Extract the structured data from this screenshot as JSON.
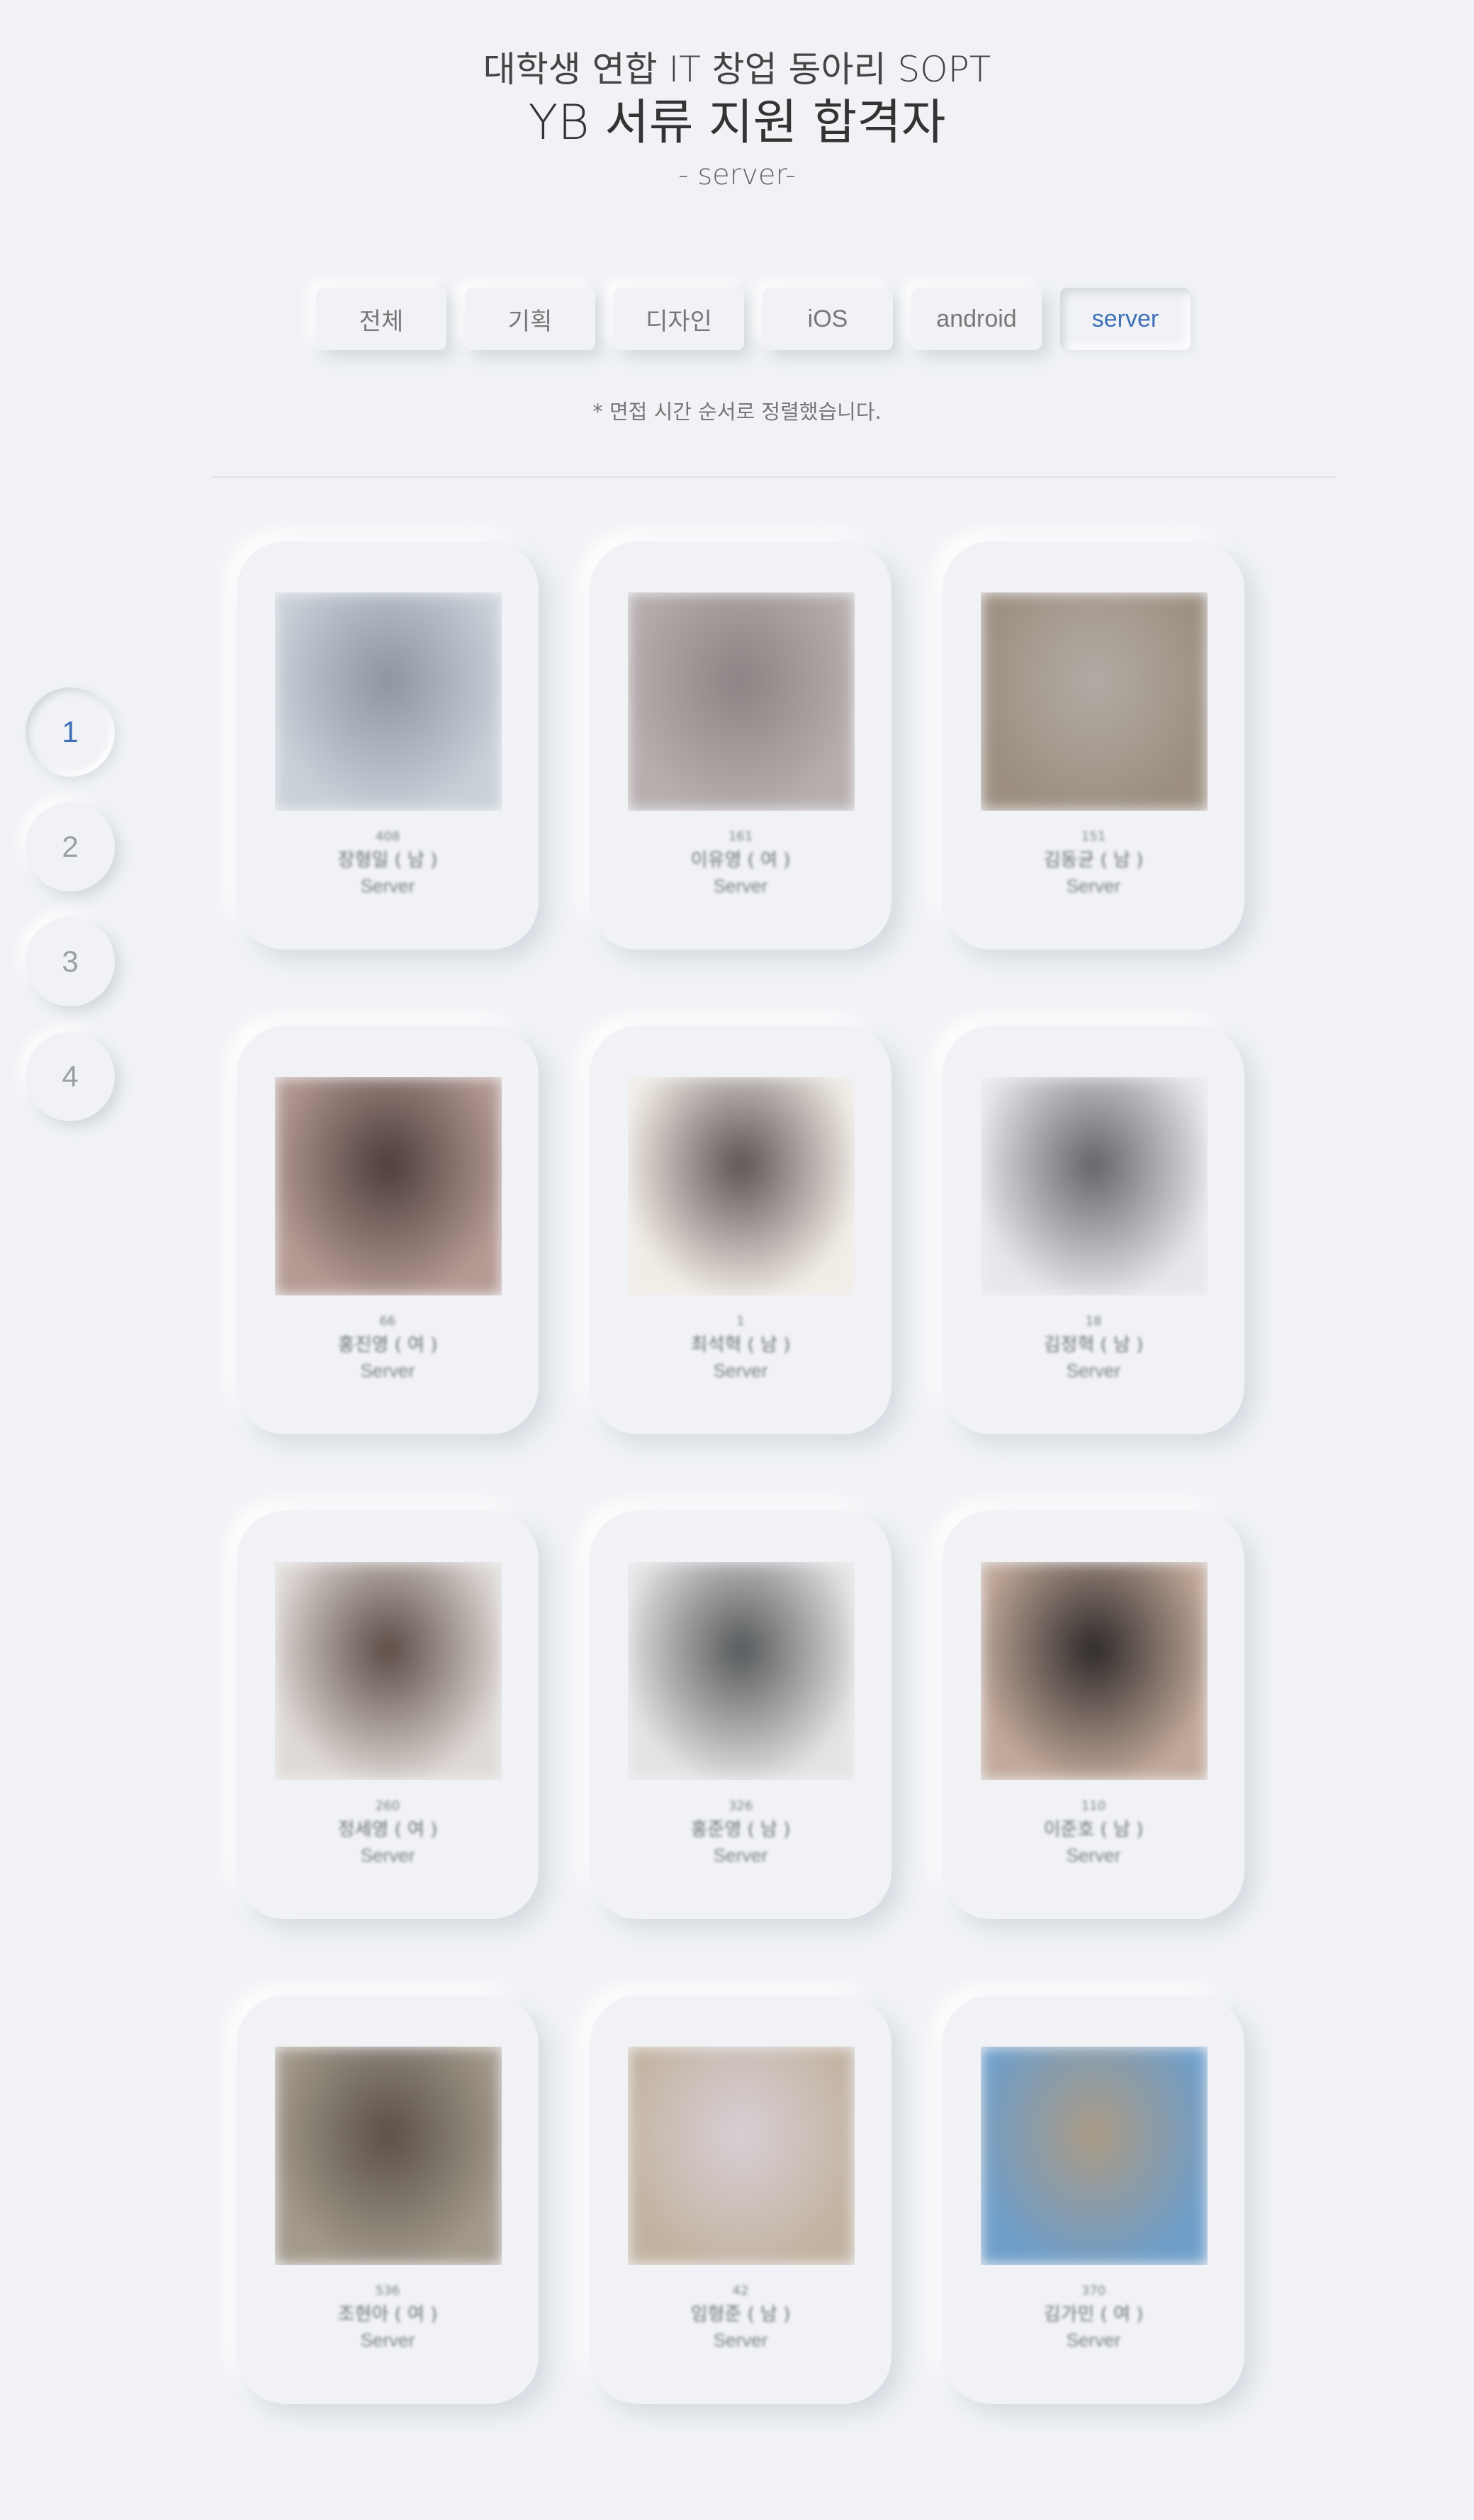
{
  "header": {
    "line1": "대학생 연합 IT 창업 동아리 SOPT",
    "line2": "YB 서류 지원 합격자",
    "subtitle": "- server-"
  },
  "tabs": [
    {
      "label": "전체",
      "active": false
    },
    {
      "label": "기획",
      "active": false
    },
    {
      "label": "디자인",
      "active": false
    },
    {
      "label": "iOS",
      "active": false
    },
    {
      "label": "android",
      "active": false
    },
    {
      "label": "server",
      "active": true
    }
  ],
  "note": "* 면접 시간 순서로 정렬했습니다.",
  "pagination": [
    {
      "label": "1",
      "active": true
    },
    {
      "label": "2",
      "active": false
    },
    {
      "label": "3",
      "active": false
    },
    {
      "label": "4",
      "active": false
    }
  ],
  "colors": {
    "accent": "#3f6fb8",
    "background": "#f0f2f5"
  },
  "cards": [
    {
      "num": "408",
      "name": "장형일 ( 남 )",
      "part": "Server",
      "photo_colors": [
        "#c9d0d8",
        "#8e95a2"
      ]
    },
    {
      "num": "161",
      "name": "이유영 ( 여 )",
      "part": "Server",
      "photo_colors": [
        "#b7aeae",
        "#8d8384"
      ]
    },
    {
      "num": "151",
      "name": "김동균 ( 남 )",
      "part": "Server",
      "photo_colors": [
        "#9c8f80",
        "#b2aba4"
      ]
    },
    {
      "num": "66",
      "name": "홍진영 ( 여 )",
      "part": "Server",
      "photo_colors": [
        "#b59a93",
        "#4d3d3b"
      ]
    },
    {
      "num": "1",
      "name": "최석혁 ( 남 )",
      "part": "Server",
      "photo_colors": [
        "#f2ece6",
        "#5d5453"
      ]
    },
    {
      "num": "18",
      "name": "김정혁 ( 남 )",
      "part": "Server",
      "photo_colors": [
        "#e6e7ed",
        "#646468"
      ]
    },
    {
      "num": "260",
      "name": "정세영 ( 여 )",
      "part": "Server",
      "photo_colors": [
        "#e0dad6",
        "#5b4b45"
      ]
    },
    {
      "num": "326",
      "name": "홍준영 ( 남 )",
      "part": "Server",
      "photo_colors": [
        "#e5e3e4",
        "#55585a"
      ]
    },
    {
      "num": "110",
      "name": "이준호 ( 남 )",
      "part": "Server",
      "photo_colors": [
        "#c2a99a",
        "#2e2a2a"
      ]
    },
    {
      "num": "536",
      "name": "조현아 ( 여 )",
      "part": "Server",
      "photo_colors": [
        "#a39a8c",
        "#5a5048"
      ]
    },
    {
      "num": "42",
      "name": "임형준 ( 남 )",
      "part": "Server",
      "photo_colors": [
        "#c2b3a1",
        "#d8cfd5"
      ]
    },
    {
      "num": "370",
      "name": "김가민 ( 여 )",
      "part": "Server",
      "photo_colors": [
        "#6f9ec9",
        "#aa9a84"
      ]
    }
  ]
}
